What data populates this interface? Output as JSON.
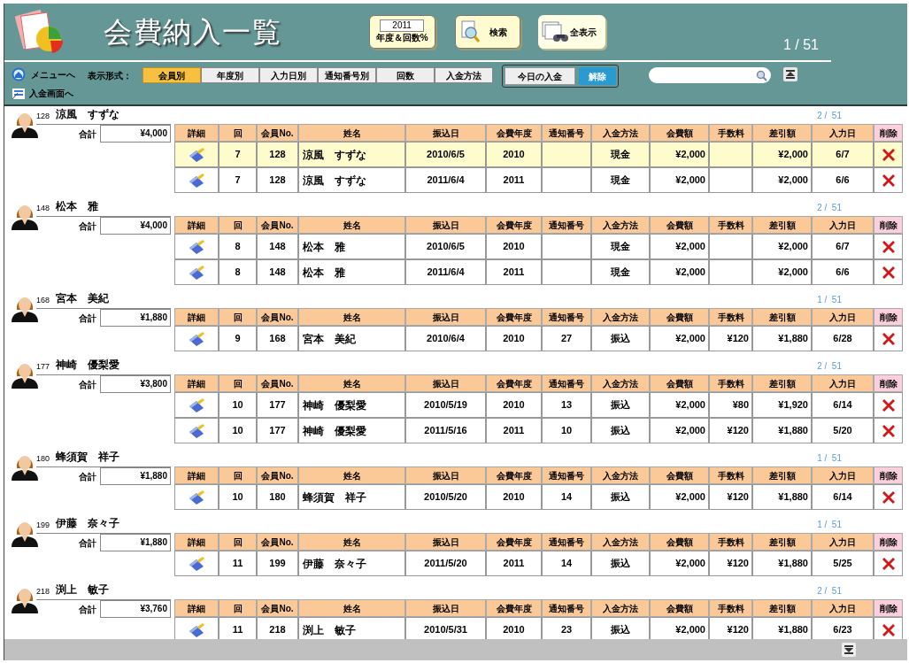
{
  "header": {
    "title": "会費納入一覧",
    "year_button": {
      "value": "2011",
      "label": "年度＆回数%"
    },
    "search_button": "検索",
    "show_all_button": "全表示",
    "page": "1 / 51"
  },
  "nav": {
    "menu_link": "メニューへ",
    "entry_link": "入金画面へ"
  },
  "view": {
    "label": "表示形式：",
    "tabs": [
      {
        "label": "会員別",
        "selected": true
      },
      {
        "label": "年度別",
        "selected": false
      },
      {
        "label": "入力日別",
        "selected": false
      },
      {
        "label": "通知番号別",
        "selected": false
      },
      {
        "label": "回数",
        "selected": false
      },
      {
        "label": "入金方法",
        "selected": false
      }
    ]
  },
  "today": {
    "label": "今日の入金",
    "clear_button": "解除"
  },
  "members": [
    {
      "columns": [
        "詳細",
        "回",
        "会員No.",
        "姓名",
        "振込日",
        "会費年度",
        "通知番号",
        "入金方法",
        "会費額",
        "手数料",
        "差引額",
        "入力日",
        "削除"
      ],
      "total_label": "合計",
      "number": "128",
      "name": "涼風　すずな",
      "total": "¥4,000",
      "page": "2 /  51",
      "rows": [
        {
          "selected": true,
          "round": "7",
          "no": "128",
          "name": "涼風　すずな",
          "date": "2010/6/5",
          "year": "2010",
          "method": "現金",
          "fee": "¥2,000",
          "net": "¥2,000",
          "entered": "6/7"
        },
        {
          "selected": false,
          "round": "7",
          "no": "128",
          "name": "涼風　すずな",
          "date": "2011/6/4",
          "year": "2011",
          "method": "現金",
          "fee": "¥2,000",
          "net": "¥2,000",
          "entered": "6/6"
        }
      ]
    },
    {
      "columns": [
        "詳細",
        "回",
        "会員No.",
        "姓名",
        "振込日",
        "会費年度",
        "通知番号",
        "入金方法",
        "会費額",
        "手数料",
        "差引額",
        "入力日",
        "削除"
      ],
      "total_label": "合計",
      "number": "148",
      "name": "松本　雅",
      "total": "¥4,000",
      "page": "2 /  51",
      "rows": [
        {
          "selected": false,
          "round": "8",
          "no": "148",
          "name": "松本　雅",
          "date": "2010/6/5",
          "year": "2010",
          "method": "現金",
          "fee": "¥2,000",
          "net": "¥2,000",
          "entered": "6/7"
        },
        {
          "selected": false,
          "round": "8",
          "no": "148",
          "name": "松本　雅",
          "date": "2011/6/4",
          "year": "2011",
          "method": "現金",
          "fee": "¥2,000",
          "net": "¥2,000",
          "entered": "6/6"
        }
      ]
    },
    {
      "columns": [
        "詳細",
        "回",
        "会員No.",
        "姓名",
        "振込日",
        "会費年度",
        "通知番号",
        "入金方法",
        "会費額",
        "手数料",
        "差引額",
        "入力日",
        "削除"
      ],
      "total_label": "合計",
      "number": "168",
      "name": "宮本　美紀",
      "total": "¥1,880",
      "page": "1 /  51",
      "rows": [
        {
          "selected": false,
          "round": "9",
          "no": "168",
          "name": "宮本　美紀",
          "date": "2010/6/4",
          "year": "2010",
          "notice": "27",
          "method": "振込",
          "fee": "¥2,000",
          "charge": "¥120",
          "net": "¥1,880",
          "entered": "6/28"
        }
      ]
    },
    {
      "columns": [
        "詳細",
        "回",
        "会員No.",
        "姓名",
        "振込日",
        "会費年度",
        "通知番号",
        "入金方法",
        "会費額",
        "手数料",
        "差引額",
        "入力日",
        "削除"
      ],
      "total_label": "合計",
      "number": "177",
      "name": "神崎　優梨愛",
      "total": "¥3,800",
      "page": "2 /  51",
      "rows": [
        {
          "selected": false,
          "round": "10",
          "no": "177",
          "name": "神崎　優梨愛",
          "date": "2010/5/19",
          "year": "2010",
          "notice": "13",
          "method": "振込",
          "fee": "¥2,000",
          "charge": "¥80",
          "net": "¥1,920",
          "entered": "6/14"
        },
        {
          "selected": false,
          "round": "10",
          "no": "177",
          "name": "神崎　優梨愛",
          "date": "2011/5/16",
          "year": "2011",
          "notice": "10",
          "method": "振込",
          "fee": "¥2,000",
          "charge": "¥120",
          "net": "¥1,880",
          "entered": "5/20"
        }
      ]
    },
    {
      "columns": [
        "詳細",
        "回",
        "会員No.",
        "姓名",
        "振込日",
        "会費年度",
        "通知番号",
        "入金方法",
        "会費額",
        "手数料",
        "差引額",
        "入力日",
        "削除"
      ],
      "total_label": "合計",
      "number": "180",
      "name": "蜂須賀　祥子",
      "total": "¥1,880",
      "page": "1 /  51",
      "rows": [
        {
          "selected": false,
          "round": "10",
          "no": "180",
          "name": "蜂須賀　祥子",
          "date": "2010/5/20",
          "year": "2010",
          "notice": "14",
          "method": "振込",
          "fee": "¥2,000",
          "charge": "¥120",
          "net": "¥1,880",
          "entered": "6/14"
        }
      ]
    },
    {
      "columns": [
        "詳細",
        "回",
        "会員No.",
        "姓名",
        "振込日",
        "会費年度",
        "通知番号",
        "入金方法",
        "会費額",
        "手数料",
        "差引額",
        "入力日",
        "削除"
      ],
      "total_label": "合計",
      "number": "199",
      "name": "伊藤　奈々子",
      "total": "¥1,880",
      "page": "1 /  51",
      "rows": [
        {
          "selected": false,
          "round": "11",
          "no": "199",
          "name": "伊藤　奈々子",
          "date": "2011/5/20",
          "year": "2011",
          "notice": "14",
          "method": "振込",
          "fee": "¥2,000",
          "charge": "¥120",
          "net": "¥1,880",
          "entered": "5/25"
        }
      ]
    },
    {
      "columns": [
        "詳細",
        "回",
        "会員No.",
        "姓名",
        "振込日",
        "会費年度",
        "通知番号",
        "入金方法",
        "会費額",
        "手数料",
        "差引額",
        "入力日",
        "削除"
      ],
      "total_label": "合計",
      "number": "218",
      "name": "渕上　敏子",
      "total": "¥3,760",
      "page": "2 /  51",
      "rows": [
        {
          "selected": false,
          "round": "11",
          "no": "218",
          "name": "渕上　敏子",
          "date": "2010/5/31",
          "year": "2010",
          "notice": "23",
          "method": "振込",
          "fee": "¥2,000",
          "charge": "¥120",
          "net": "¥1,880",
          "entered": "6/23"
        }
      ]
    }
  ]
}
